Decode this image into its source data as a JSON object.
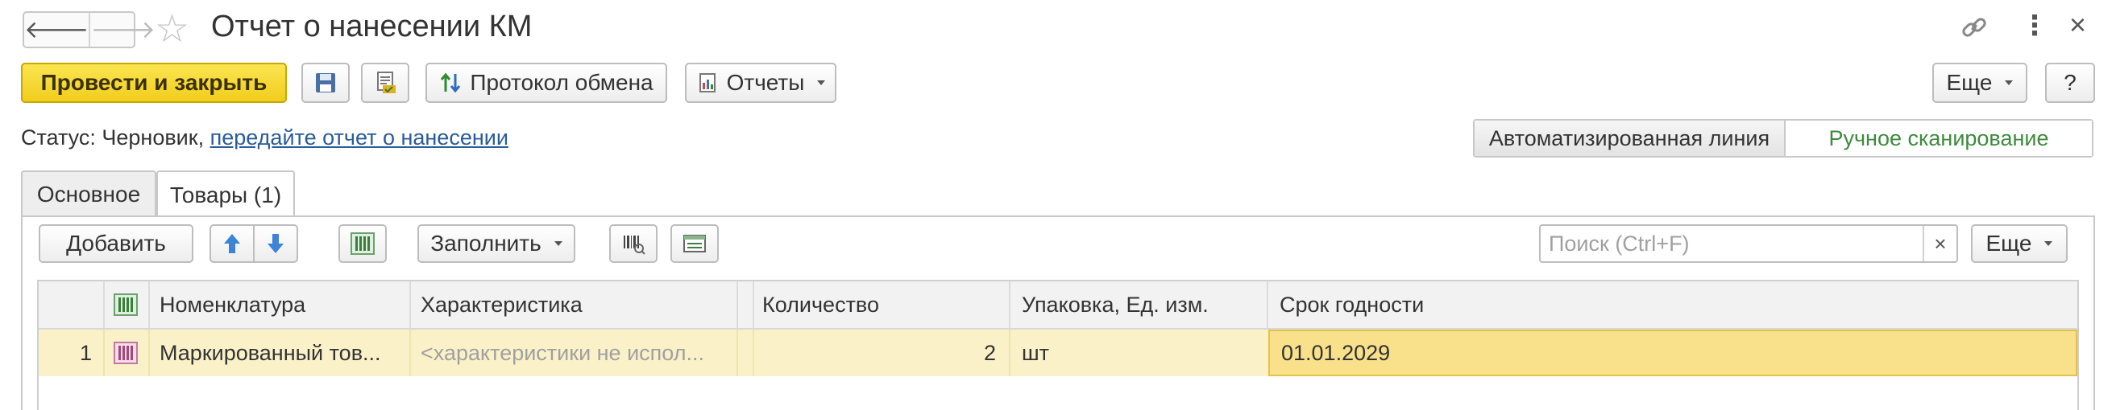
{
  "window": {
    "title": "Отчет о нанесении КМ",
    "nav_back": "🡐",
    "nav_forward": "🡒",
    "favorite_glyph": "☆",
    "link_glyph": "🔗",
    "more_glyph": "⋮",
    "close_glyph": "×"
  },
  "toolbar": {
    "post_close": "Провести и закрыть",
    "exchange_protocol": "Протокол обмена",
    "reports": "Отчеты",
    "more": "Еще",
    "help": "?"
  },
  "status": {
    "label": "Статус:",
    "value": "Черновик,",
    "link": "передайте отчет о нанесении"
  },
  "mode": {
    "automated": "Автоматизированная линия",
    "manual": "Ручное сканирование"
  },
  "tabs": [
    {
      "label": "Основное"
    },
    {
      "label": "Товары (1)"
    }
  ],
  "goods_toolbar": {
    "add": "Добавить",
    "fill": "Заполнить",
    "search_placeholder": "Поиск (Ctrl+F)",
    "clear": "×",
    "more": "Еще"
  },
  "table": {
    "columns": [
      "Номенклатура",
      "Характеристика",
      "Количество",
      "Упаковка, Ед. изм.",
      "Срок годности"
    ],
    "rows": [
      {
        "n": "1",
        "nomenclature": "Маркированный тов...",
        "characteristic": "<характеристики не испол...",
        "quantity": "2",
        "unit": "шт",
        "expiry": "01.01.2029"
      }
    ]
  },
  "colors": {
    "primary_button": "#f1cd1d",
    "selected_row": "#fbf1c8",
    "link": "#2a5c99",
    "manual_mode_text": "#3e8a3e"
  }
}
